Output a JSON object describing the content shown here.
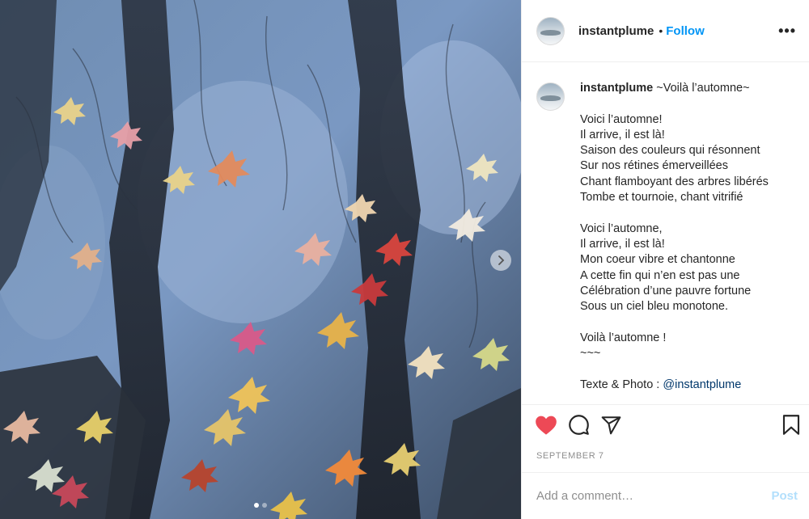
{
  "header": {
    "username": "instantplume",
    "separator": "•",
    "follow_label": "Follow",
    "more_label": "•••"
  },
  "caption": {
    "username": "instantplume",
    "title": "~Voilà l’automne~",
    "lines": [
      "Voici l’automne!",
      "Il arrive, il est là!",
      "Saison des couleurs qui résonnent",
      "Sur nos rétines émerveillées",
      "Chant flamboyant des arbres libérés",
      "Tombe et tournoie, chant vitrifié",
      "",
      "Voici l’automne,",
      "Il arrive, il est là!",
      "Mon coeur vibre et chantonne",
      "A cette fin qui n’en est pas une",
      "Célébration d’une pauvre fortune",
      "Sous un ciel bleu monotone.",
      "",
      "Voilà l’automne !",
      "~~~",
      ""
    ],
    "credit_prefix": "Texte & Photo : ",
    "credit_mention": "@instantplume"
  },
  "actions": {
    "like_icon": "heart-filled-icon",
    "comment_icon": "comment-bubble-icon",
    "share_icon": "paper-plane-icon",
    "save_icon": "bookmark-icon",
    "like_color": "#ed4956"
  },
  "date": "SEPTEMBER 7",
  "comment": {
    "placeholder": "Add a comment…",
    "post_label": "Post"
  },
  "media": {
    "next_icon": "chevron-right-icon",
    "carousel_dots": 2,
    "active_dot": 0
  },
  "colors": {
    "accent": "#0095f6",
    "mention": "#00376b",
    "muted": "#8e8e8e",
    "post_disabled": "#b2dffc"
  }
}
